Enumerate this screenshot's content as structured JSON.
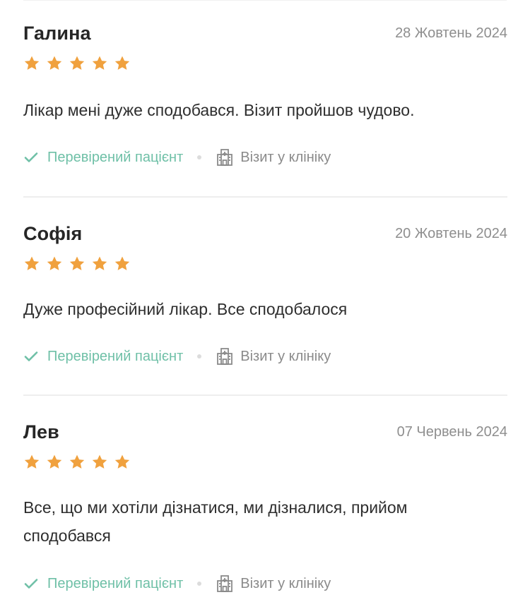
{
  "colors": {
    "star": "#f0a13e",
    "verified": "#6fc0a7",
    "muted": "#8a8a8a",
    "divider": "#eeeeee"
  },
  "reviews": [
    {
      "name": "Галина",
      "date": "28 Жовтень 2024",
      "rating": 5,
      "text": "Лікар мені дуже сподобався. Візит пройшов чудово.",
      "verified_label": "Перевірений пацієнт",
      "visit_label": "Візит у клініку"
    },
    {
      "name": "Софія",
      "date": "20 Жовтень 2024",
      "rating": 5,
      "text": "Дуже професійний лікар. Все сподобалося",
      "verified_label": "Перевірений пацієнт",
      "visit_label": "Візит у клініку"
    },
    {
      "name": "Лев",
      "date": "07 Червень 2024",
      "rating": 5,
      "text": "Все, що ми хотіли дізнатися, ми дізналися, прийом сподобався",
      "verified_label": "Перевірений пацієнт",
      "visit_label": "Візит у клініку"
    }
  ],
  "icons": {
    "star": "star-icon",
    "verified": "check-icon",
    "visit": "hospital-icon"
  }
}
